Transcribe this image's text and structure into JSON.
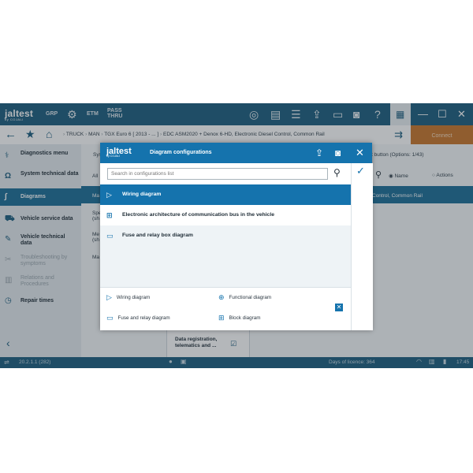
{
  "app": {
    "logo": "jaltest",
    "logo_sub": "by COJALI",
    "toolbar": [
      "GRP",
      "ETM",
      "PASS THRU"
    ],
    "connect_label": "Connect"
  },
  "breadcrumb": {
    "items": [
      "TRUCK",
      "MAN",
      "TGX Euro 6 [ 2013 - ... ]",
      "EDC ASM2020 + Denox 6-HD, Electronic Diesel Control, Common Rail"
    ]
  },
  "sidebar": {
    "items": [
      {
        "label": "Diagnostics menu",
        "icon": "diagnostics-icon"
      },
      {
        "label": "System technical data",
        "icon": "omega-icon"
      },
      {
        "label": "Diagrams",
        "icon": "diagram-icon",
        "active": true
      },
      {
        "label": "Vehicle service data",
        "icon": "truck-icon"
      },
      {
        "label": "Vehicle technical data",
        "icon": "wrench-icon"
      },
      {
        "label": "Troubleshooting by symptoms",
        "icon": "tools-icon",
        "dim": true
      },
      {
        "label": "Relations and Procedures",
        "icon": "document-icon",
        "dim": true
      },
      {
        "label": "Repair times",
        "icon": "clock-icon"
      }
    ]
  },
  "background": {
    "right_hint": "t button (Options: 1/43)",
    "radio_name": "Name",
    "radio_actions": "Actions",
    "right_band": "Control, Common Rail",
    "col_label_1": "Sys",
    "col_label_2": "All",
    "col_label_3": "Ma",
    "col_label_4": "Spe (sh",
    "col_label_5": "Me (sh",
    "col_label_6": "Ma",
    "bottom_card": "Data registration, telematics and ..."
  },
  "status": {
    "version": "20.2.1.1 (282)",
    "licence": "Days of licence: 364",
    "time": "17:45"
  },
  "dialog": {
    "logo": "jaltest",
    "logo_sub": "by COJALI",
    "title": "Diagram configurations",
    "search_placeholder": "Search in configurations list",
    "items": [
      {
        "label": "Wiring diagram",
        "icon": "wiring-diagram-icon",
        "selected": true
      },
      {
        "label": "Electronic architecture of communication bus in the vehicle",
        "icon": "block-diagram-icon"
      },
      {
        "label": "Fuse and relay box diagram",
        "icon": "fuse-relay-icon"
      }
    ],
    "legend": [
      {
        "label": "Wiring diagram",
        "icon": "wiring-diagram-icon"
      },
      {
        "label": "Functional diagram",
        "icon": "functional-diagram-icon"
      },
      {
        "label": "Fuse and relay diagram",
        "icon": "fuse-relay-icon"
      },
      {
        "label": "Block diagram",
        "icon": "block-diagram-icon"
      }
    ]
  },
  "colors": {
    "brand": "#1b5d7e",
    "accent": "#1573ad",
    "connect": "#c8762a"
  }
}
